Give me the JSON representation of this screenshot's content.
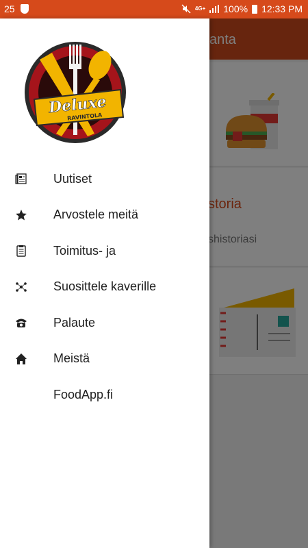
{
  "status_bar": {
    "notification_count": "25",
    "network": "4G+",
    "battery": "100%",
    "time": "12:33 PM"
  },
  "background_app": {
    "title": "vanta",
    "card2_title": "storia",
    "card2_subtitle": "shistoriasi"
  },
  "drawer": {
    "logo": {
      "title": "Deluxe",
      "subtitle": "RAVINTOLA"
    },
    "items": [
      {
        "label": "Uutiset",
        "icon": "newspaper-icon"
      },
      {
        "label": "Arvostele meitä",
        "icon": "star-icon"
      },
      {
        "label": "Toimitus- ja",
        "icon": "clipboard-icon"
      },
      {
        "label": "Suosittele kaverille",
        "icon": "share-icon"
      },
      {
        "label": "Palaute",
        "icon": "phone-icon"
      },
      {
        "label": "Meistä",
        "icon": "home-icon"
      },
      {
        "label": "FoodApp.fi",
        "icon": ""
      }
    ]
  },
  "colors": {
    "accent": "#d64a1b",
    "brand_yellow": "#f2b400",
    "brand_red": "#a5141b"
  }
}
